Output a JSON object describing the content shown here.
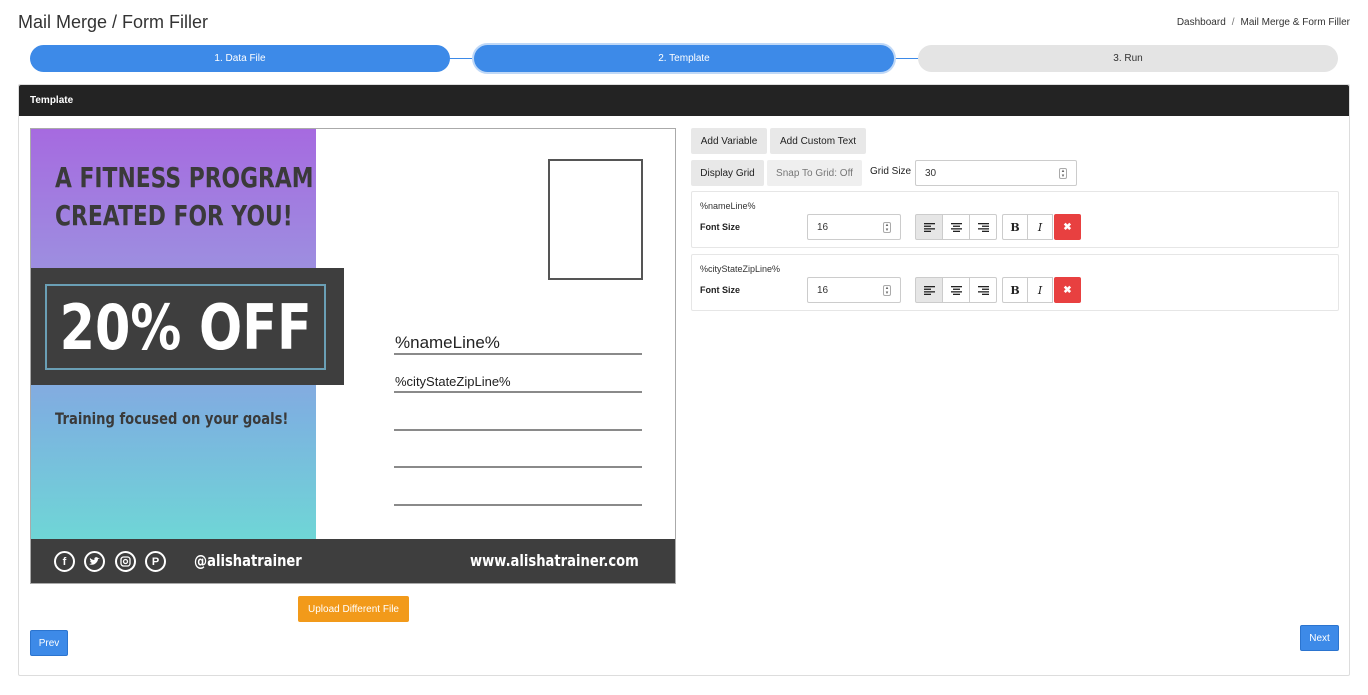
{
  "page": {
    "title": "Mail Merge / Form Filler",
    "breadcrumb": [
      "Dashboard",
      "Mail Merge & Form Filler"
    ]
  },
  "steps": [
    {
      "label": "1. Data File",
      "state": "complete"
    },
    {
      "label": "2. Template",
      "state": "current"
    },
    {
      "label": "3. Run",
      "state": "inactive"
    }
  ],
  "card": {
    "header": "Template"
  },
  "postcard": {
    "headline_1": "A FITNESS PROGRAM",
    "headline_2": "CREATED FOR YOU!",
    "offer": "20% OFF",
    "tagline": "Training focused on your goals!",
    "handle": "@alishatrainer",
    "website": "www.alishatrainer.com",
    "fields": [
      "%nameLine%",
      "%cityStateZipLine%"
    ],
    "social_icons": [
      "facebook-icon",
      "twitter-icon",
      "instagram-icon",
      "pinterest-icon"
    ]
  },
  "toolbar": {
    "add_variable": "Add Variable",
    "add_custom_text": "Add Custom Text",
    "display_grid": "Display Grid",
    "snap_to_grid": "Snap To Grid: Off",
    "grid_size_label": "Grid Size",
    "grid_size_value": "30"
  },
  "variables": [
    {
      "name": "%nameLine%",
      "font_size_label": "Font Size",
      "font_size": "16"
    },
    {
      "name": "%cityStateZipLine%",
      "font_size_label": "Font Size",
      "font_size": "16"
    }
  ],
  "style_buttons": {
    "bold": "B",
    "italic": "I",
    "delete": "✖"
  },
  "buttons": {
    "upload": "Upload Different File",
    "prev": "Prev",
    "next": "Next"
  },
  "colors": {
    "primary": "#3d8ae8",
    "header_bg": "#232323",
    "upload": "#f29a1a",
    "danger": "#e84040"
  }
}
